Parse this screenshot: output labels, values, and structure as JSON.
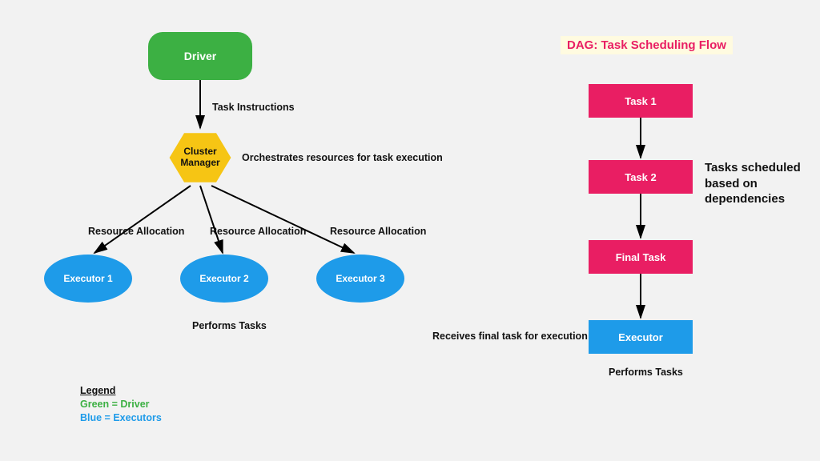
{
  "left": {
    "driver": "Driver",
    "driver_to_cm": "Task Instructions",
    "cluster_manager": "Cluster Manager",
    "cm_note": "Orchestrates resources for task execution",
    "alloc": "Resource Allocation",
    "executors": [
      "Executor 1",
      "Executor 2",
      "Executor 3"
    ],
    "exec_note": "Performs Tasks"
  },
  "right": {
    "title": "DAG: Task Scheduling Flow",
    "tasks": [
      "Task 1",
      "Task 2",
      "Final Task"
    ],
    "side_note": "Tasks scheduled based on dependencies",
    "exec_in_note": "Receives final task for execution",
    "executor": "Executor",
    "exec_note": "Performs Tasks"
  },
  "legend": {
    "header": "Legend",
    "line1": "Green = Driver",
    "line2": "Blue = Executors"
  },
  "colors": {
    "green": "#3cb043",
    "blue": "#1e9be9",
    "pink": "#e91e63",
    "yellow": "#f6c514"
  }
}
